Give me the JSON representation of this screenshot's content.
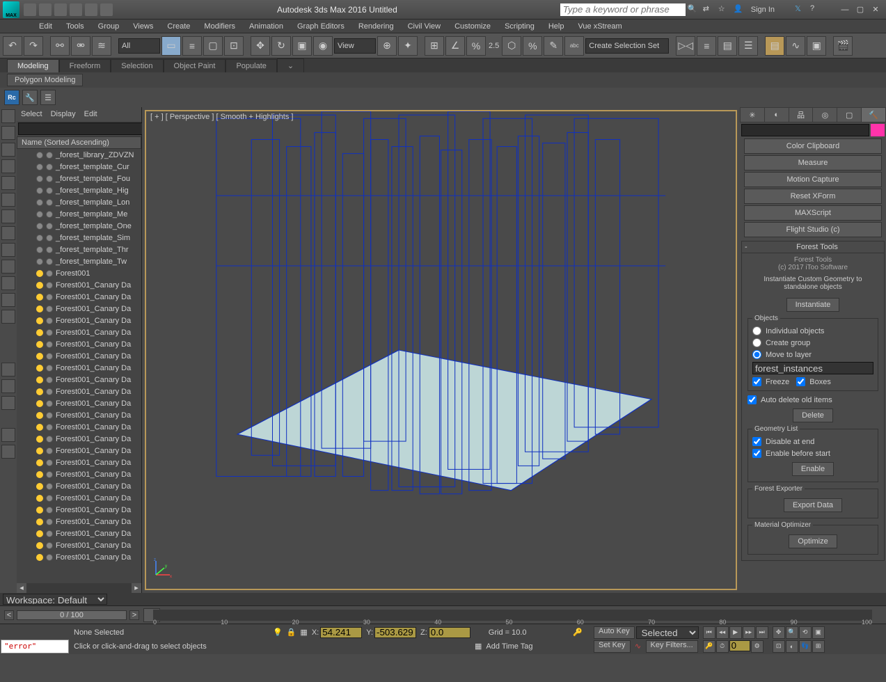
{
  "title": "Autodesk 3ds Max 2016    Untitled",
  "logo_text": "MAX",
  "search_placeholder": "Type a keyword or phrase",
  "signin": "Sign In",
  "menu": [
    "Edit",
    "Tools",
    "Group",
    "Views",
    "Create",
    "Modifiers",
    "Animation",
    "Graph Editors",
    "Rendering",
    "Civil View",
    "Customize",
    "Scripting",
    "Help",
    "Vue xStream"
  ],
  "toolbar_dropdown_all": "All",
  "toolbar_dropdown_view": "View",
  "toolbar_spinner": "2.5",
  "toolbar_selset": "Create Selection Set",
  "ribbon_tabs": [
    "Modeling",
    "Freeform",
    "Selection",
    "Object Paint",
    "Populate"
  ],
  "ribbon_sub": "Polygon Modeling",
  "toolrow_rc": "Rc",
  "explorer": {
    "menu": [
      "Select",
      "Display",
      "Edit"
    ],
    "col_header": "Name (Sorted Ascending)",
    "items": [
      {
        "type": "obj",
        "name": "_forest_library_ZDVZN"
      },
      {
        "type": "obj",
        "name": "_forest_template_Cur"
      },
      {
        "type": "obj",
        "name": "_forest_template_Fou"
      },
      {
        "type": "obj",
        "name": "_forest_template_Hig"
      },
      {
        "type": "obj",
        "name": "_forest_template_Lon"
      },
      {
        "type": "obj",
        "name": "_forest_template_Me"
      },
      {
        "type": "obj",
        "name": "_forest_template_One"
      },
      {
        "type": "obj",
        "name": "_forest_template_Sim"
      },
      {
        "type": "obj",
        "name": "_forest_template_Thr"
      },
      {
        "type": "obj",
        "name": "_forest_template_Tw"
      },
      {
        "type": "bulb",
        "name": "Forest001"
      },
      {
        "type": "bulb",
        "name": "Forest001_Canary Da"
      },
      {
        "type": "bulb",
        "name": "Forest001_Canary Da"
      },
      {
        "type": "bulb",
        "name": "Forest001_Canary Da"
      },
      {
        "type": "bulb",
        "name": "Forest001_Canary Da"
      },
      {
        "type": "bulb",
        "name": "Forest001_Canary Da"
      },
      {
        "type": "bulb",
        "name": "Forest001_Canary Da"
      },
      {
        "type": "bulb",
        "name": "Forest001_Canary Da"
      },
      {
        "type": "bulb",
        "name": "Forest001_Canary Da"
      },
      {
        "type": "bulb",
        "name": "Forest001_Canary Da"
      },
      {
        "type": "bulb",
        "name": "Forest001_Canary Da"
      },
      {
        "type": "bulb",
        "name": "Forest001_Canary Da"
      },
      {
        "type": "bulb",
        "name": "Forest001_Canary Da"
      },
      {
        "type": "bulb",
        "name": "Forest001_Canary Da"
      },
      {
        "type": "bulb",
        "name": "Forest001_Canary Da"
      },
      {
        "type": "bulb",
        "name": "Forest001_Canary Da"
      },
      {
        "type": "bulb",
        "name": "Forest001_Canary Da"
      },
      {
        "type": "bulb",
        "name": "Forest001_Canary Da"
      },
      {
        "type": "bulb",
        "name": "Forest001_Canary Da"
      },
      {
        "type": "bulb",
        "name": "Forest001_Canary Da"
      },
      {
        "type": "bulb",
        "name": "Forest001_Canary Da"
      },
      {
        "type": "bulb",
        "name": "Forest001_Canary Da"
      },
      {
        "type": "bulb",
        "name": "Forest001_Canary Da"
      },
      {
        "type": "bulb",
        "name": "Forest001_Canary Da"
      },
      {
        "type": "bulb",
        "name": "Forest001_Canary Da"
      }
    ]
  },
  "viewport_label": "[ + ] [ Perspective ] [ Smooth + Highlights ]",
  "right": {
    "utils": [
      "Color Clipboard",
      "Measure",
      "Motion Capture",
      "Reset XForm",
      "MAXScript",
      "Flight Studio (c)"
    ],
    "roll_header": "Forest Tools",
    "copyright1": "Forest Tools",
    "copyright2": "(c) 2017 iToo Software",
    "inst_header": "Instantiate Custom Geometry to standalone objects",
    "instantiate_btn": "Instantiate",
    "objects_legend": "Objects",
    "radio_individual": "Individual objects",
    "radio_group": "Create group",
    "radio_layer": "Move to layer",
    "layer_value": "forest_instances",
    "chk_freeze": "Freeze",
    "chk_boxes": "Boxes",
    "chk_autodelete": "Auto delete old items",
    "delete_btn": "Delete",
    "geom_legend": "Geometry List",
    "chk_disable_end": "Disable at end",
    "chk_enable_start": "Enable before start",
    "enable_btn": "Enable",
    "exporter_legend": "Forest Exporter",
    "export_btn": "Export Data",
    "matopt_legend": "Material Optimizer",
    "optimize_btn": "Optimize"
  },
  "workspace_label": "Workspace: Default",
  "timeline": {
    "frames": "0 / 100",
    "ticks": [
      "0",
      "10",
      "20",
      "30",
      "40",
      "50",
      "60",
      "70",
      "80",
      "90",
      "100"
    ]
  },
  "status": {
    "error": "\"error\"",
    "none_selected": "None Selected",
    "hint": "Click or click-and-drag to select objects",
    "x": "54.241",
    "y": "-503.629",
    "z": "0.0",
    "grid": "Grid = 10.0",
    "add_time_tag": "Add Time Tag",
    "auto_key": "Auto Key",
    "set_key": "Set Key",
    "selected": "Selected",
    "key_filters": "Key Filters...",
    "nav_val": "0"
  }
}
